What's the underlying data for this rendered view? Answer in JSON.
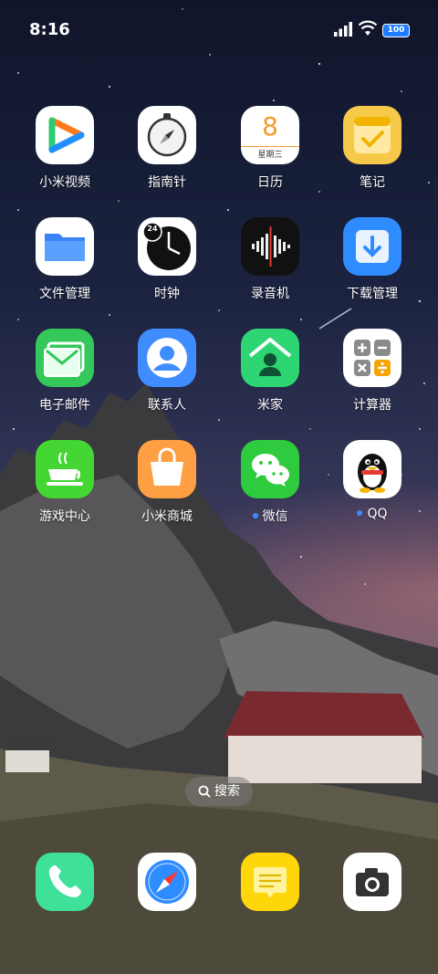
{
  "status_bar": {
    "time": "8:16",
    "battery_level": "100",
    "battery_color": "#1f7cff"
  },
  "apps": [
    {
      "label": "小米视频",
      "icon": "mi-video-icon"
    },
    {
      "label": "指南针",
      "icon": "compass-icon"
    },
    {
      "label": "日历",
      "icon": "calendar-icon",
      "day": "8",
      "weekday": "星期三"
    },
    {
      "label": "笔记",
      "icon": "notes-icon"
    },
    {
      "label": "文件管理",
      "icon": "folder-icon"
    },
    {
      "label": "时钟",
      "icon": "clock-icon",
      "badge": "24"
    },
    {
      "label": "录音机",
      "icon": "recorder-icon"
    },
    {
      "label": "下载管理",
      "icon": "download-icon"
    },
    {
      "label": "电子邮件",
      "icon": "mail-icon"
    },
    {
      "label": "联系人",
      "icon": "contacts-icon"
    },
    {
      "label": "米家",
      "icon": "mijia-icon"
    },
    {
      "label": "计算器",
      "icon": "calculator-icon"
    },
    {
      "label": "游戏中心",
      "icon": "game-center-icon"
    },
    {
      "label": "小米商城",
      "icon": "mi-store-icon"
    },
    {
      "label": "微信",
      "icon": "wechat-icon",
      "new_dot": true
    },
    {
      "label": "QQ",
      "icon": "qq-icon",
      "new_dot": true
    }
  ],
  "search": {
    "label": "搜索"
  },
  "dock": [
    {
      "icon": "phone-icon"
    },
    {
      "icon": "browser-icon"
    },
    {
      "icon": "messages-icon"
    },
    {
      "icon": "camera-icon"
    }
  ]
}
